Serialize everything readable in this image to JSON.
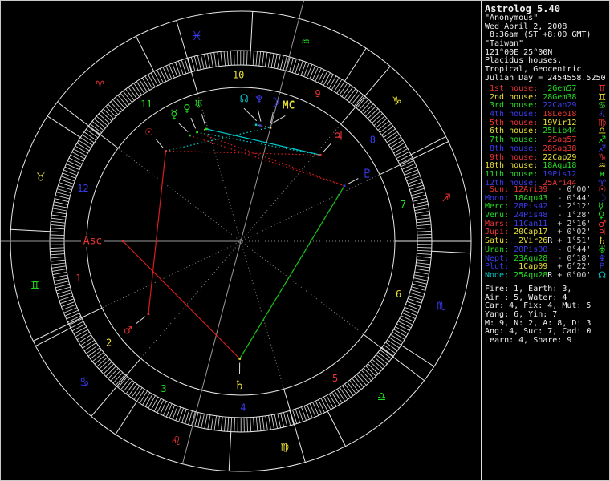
{
  "app": {
    "title": "Astrolog 5.40"
  },
  "header": {
    "lines": [
      "\"Anonymous\"",
      "Wed April 2, 2008",
      " 8:36am (ST +8:00 GMT)",
      "\"Taiwan\"",
      "121°00E 25°00N",
      "Placidus houses.",
      "Tropical, Geocentric.",
      "Julian Day = 2454558.5250"
    ]
  },
  "palette": {
    "fire": "#ee3232",
    "earth": "#e8e033",
    "air": "#21dd21",
    "water": "#3b3bee",
    "red": "#ee3232",
    "yellow": "#e8e033",
    "green": "#21dd21",
    "blue": "#3b3bee",
    "cyan": "#00c8c8",
    "white": "#f0f0f0",
    "dim": "#cfcfcf",
    "gray_line": "#9a9a9a",
    "dot_line": "#8f8f8f",
    "ring": "#e9e9e9",
    "tick": "#d8d8d8",
    "aspect_red": "#dd1c1c",
    "aspect_green": "#17c517",
    "aspect_cyan": "#00cdcd",
    "aspect_yellow": "#e3e300"
  },
  "signs": [
    {
      "name": "aries",
      "glyph": "♈",
      "element": "fire"
    },
    {
      "name": "taurus",
      "glyph": "♉",
      "element": "earth"
    },
    {
      "name": "gemini",
      "glyph": "♊",
      "element": "air"
    },
    {
      "name": "cancer",
      "glyph": "♋",
      "element": "water"
    },
    {
      "name": "leo",
      "glyph": "♌",
      "element": "fire"
    },
    {
      "name": "virgo",
      "glyph": "♍",
      "element": "earth"
    },
    {
      "name": "libra",
      "glyph": "♎",
      "element": "air"
    },
    {
      "name": "scorpio",
      "glyph": "♏",
      "element": "water"
    },
    {
      "name": "sagittarius",
      "glyph": "♐",
      "element": "fire"
    },
    {
      "name": "capricorn",
      "glyph": "♑",
      "element": "earth"
    },
    {
      "name": "aquarius",
      "glyph": "♒",
      "element": "air"
    },
    {
      "name": "pisces",
      "glyph": "♓",
      "element": "water"
    }
  ],
  "houses": [
    {
      "num": 1,
      "label": " 1st house:",
      "value": " 2Gem57",
      "lon": 62.95,
      "label_color": "fire",
      "value_color": "air",
      "glyph": "♊",
      "glyph_color": "fire"
    },
    {
      "num": 2,
      "label": " 2nd house:",
      "value": "28Gem38",
      "lon": 88.63,
      "label_color": "earth",
      "value_color": "air",
      "glyph": "♊",
      "glyph_color": "earth"
    },
    {
      "num": 3,
      "label": " 3rd house:",
      "value": "22Can29",
      "lon": 112.48,
      "label_color": "air",
      "value_color": "water",
      "glyph": "♋",
      "glyph_color": "air"
    },
    {
      "num": 4,
      "label": " 4th house:",
      "value": "18Leo18",
      "lon": 138.3,
      "label_color": "water",
      "value_color": "fire",
      "glyph": "♌",
      "glyph_color": "water"
    },
    {
      "num": 5,
      "label": " 5th house:",
      "value": "19Vir12",
      "lon": 169.2,
      "label_color": "fire",
      "value_color": "earth",
      "glyph": "♍",
      "glyph_color": "fire"
    },
    {
      "num": 6,
      "label": " 6th house:",
      "value": "25Lib44",
      "lon": 205.73,
      "label_color": "earth",
      "value_color": "air",
      "glyph": "♎",
      "glyph_color": "earth"
    },
    {
      "num": 7,
      "label": " 7th house:",
      "value": " 2Sag57",
      "lon": 242.95,
      "label_color": "air",
      "value_color": "fire",
      "glyph": "♐",
      "glyph_color": "air"
    },
    {
      "num": 8,
      "label": " 8th house:",
      "value": "28Sag38",
      "lon": 268.63,
      "label_color": "water",
      "value_color": "fire",
      "glyph": "♐",
      "glyph_color": "water"
    },
    {
      "num": 9,
      "label": " 9th house:",
      "value": "22Cap29",
      "lon": 292.48,
      "label_color": "fire",
      "value_color": "earth",
      "glyph": "♑",
      "glyph_color": "fire"
    },
    {
      "num": 10,
      "label": "10th house:",
      "value": "18Aqu18",
      "lon": 318.3,
      "label_color": "earth",
      "value_color": "air",
      "glyph": "♒",
      "glyph_color": "earth"
    },
    {
      "num": 11,
      "label": "11th house:",
      "value": "19Pis12",
      "lon": 349.2,
      "label_color": "air",
      "value_color": "water",
      "glyph": "♓",
      "glyph_color": "air"
    },
    {
      "num": 12,
      "label": "12th house:",
      "value": "25Ari44",
      "lon": 25.73,
      "label_color": "water",
      "value_color": "fire",
      "glyph": "♈",
      "glyph_color": "water"
    }
  ],
  "planets": [
    {
      "key": "Sun",
      "name": " Sun:",
      "value": "12Ari39",
      "retro": " ",
      "motion": "- 0°00'",
      "glyph": "☉",
      "color": "red",
      "value_color": "fire",
      "lon": 12.65,
      "disp_lon": 12.65
    },
    {
      "key": "Moon",
      "name": "Moon:",
      "value": "18Aqu43",
      "retro": " ",
      "motion": "- 0°44'",
      "glyph": "☽",
      "color": "blue",
      "value_color": "air",
      "lon": 318.717,
      "disp_lon": 318.9
    },
    {
      "key": "Merc",
      "name": "Merc:",
      "value": "28Pis42",
      "retro": " ",
      "motion": "- 2°12'",
      "glyph": "☿",
      "color": "green",
      "value_color": "water",
      "lon": 358.7,
      "disp_lon": 0.65
    },
    {
      "key": "Venu",
      "name": "Venu:",
      "value": "24Pis48",
      "retro": " ",
      "motion": "- 1°28'",
      "glyph": "♀",
      "color": "green",
      "value_color": "water",
      "lon": 354.8,
      "disp_lon": 354.95
    },
    {
      "key": "Mars",
      "name": "Mars:",
      "value": "11Can11",
      "retro": " ",
      "motion": "+ 2°16'",
      "glyph": "♂",
      "color": "red",
      "value_color": "water",
      "lon": 101.183,
      "disp_lon": 101.183
    },
    {
      "key": "Jupi",
      "name": "Jupi:",
      "value": "20Cap17",
      "retro": " ",
      "motion": "+ 0°02'",
      "glyph": "♃",
      "color": "red",
      "value_color": "earth",
      "lon": 290.283,
      "disp_lon": 290.283
    },
    {
      "key": "Satu",
      "name": "Satu:",
      "value": " 2Vir26",
      "retro": "R",
      "motion": "+ 1°51'",
      "glyph": "♄",
      "color": "yellow",
      "value_color": "earth",
      "lon": 152.433,
      "disp_lon": 152.433
    },
    {
      "key": "Uran",
      "name": "Uran:",
      "value": "20Pis00",
      "retro": " ",
      "motion": "- 0°44'",
      "glyph": "♅",
      "color": "green",
      "value_color": "water",
      "lon": 350.0,
      "disp_lon": 350.0
    },
    {
      "key": "Nept",
      "name": "Nept:",
      "value": "23Aqu28",
      "retro": " ",
      "motion": "- 0°18'",
      "glyph": "♆",
      "color": "blue",
      "value_color": "air",
      "lon": 323.467,
      "disp_lon": 325.6
    },
    {
      "key": "Plut",
      "name": "Plut:",
      "value": " 1Cap09",
      "retro": " ",
      "motion": "+ 6°22'",
      "glyph": "♇",
      "color": "blue",
      "value_color": "earth",
      "lon": 271.15,
      "disp_lon": 271.15
    },
    {
      "key": "Node",
      "name": "Node:",
      "value": "25Aqu28",
      "retro": "R",
      "motion": "+ 0°00'",
      "glyph": "☊",
      "color": "cyan",
      "value_color": "air",
      "lon": 325.467,
      "disp_lon": 331.6
    }
  ],
  "angles": {
    "asc": {
      "label": "Asc",
      "lon": 62.95,
      "color": "red"
    },
    "mc": {
      "label": "MC",
      "lon": 318.3,
      "disp_lon": 313.5,
      "color": "yellow"
    }
  },
  "aspects": [
    {
      "a": "Sun",
      "b": "Mars",
      "color": "aspect_red",
      "style": "solid"
    },
    {
      "a": "Asc",
      "b": "Satu",
      "color": "aspect_red",
      "style": "solid"
    },
    {
      "a": "Satu",
      "b": "Plut",
      "color": "aspect_green",
      "style": "solid"
    },
    {
      "a": "Uran",
      "b": "Jupi",
      "color": "aspect_cyan",
      "style": "solid"
    },
    {
      "a": "Sun",
      "b": "Jupi",
      "color": "aspect_red",
      "style": "dotted"
    },
    {
      "a": "Merc",
      "b": "Plut",
      "color": "aspect_red",
      "style": "dotted"
    },
    {
      "a": "Venu",
      "b": "Plut",
      "color": "aspect_red",
      "style": "dotted"
    },
    {
      "a": "Sun",
      "b": "Moon",
      "color": "aspect_cyan",
      "style": "dotted"
    },
    {
      "a": "Venu",
      "b": "Jupi",
      "color": "aspect_cyan",
      "style": "dotted"
    },
    {
      "a": "Venu",
      "b": "Uran",
      "color": "aspect_yellow",
      "style": "dotted"
    },
    {
      "a": "Moon",
      "b": "Node",
      "color": "aspect_yellow",
      "style": "dotted"
    }
  ],
  "tally": {
    "lines": [
      "Fire: 1, Earth: 3,",
      "Air : 5, Water: 4",
      "Car: 4, Fix: 4, Mut: 5",
      "Yang: 6, Yin: 7",
      "M: 9, N: 2, A: 8, D: 3",
      "Ang: 4, Suc: 7, Cad: 0",
      "Learn: 4, Share: 9"
    ]
  }
}
